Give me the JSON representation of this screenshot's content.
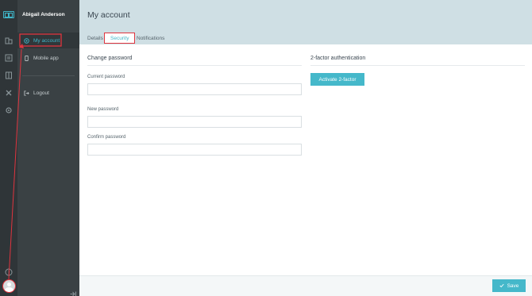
{
  "user": {
    "name": "Abigail Anderson"
  },
  "sidebar": {
    "items": [
      {
        "label": "My account",
        "icon": "gear-circle-icon"
      },
      {
        "label": "Mobile app",
        "icon": "mobile-icon"
      },
      {
        "label": "Logout",
        "icon": "logout-icon"
      }
    ]
  },
  "rail": {
    "icons": [
      "building-icon",
      "list-icon",
      "book-icon",
      "tools-icon",
      "gear-icon"
    ]
  },
  "page": {
    "title": "My account"
  },
  "tabs": [
    {
      "label": "Details"
    },
    {
      "label": "Security"
    },
    {
      "label": "Notifications"
    }
  ],
  "change_password": {
    "title": "Change password",
    "current_label": "Current password",
    "current_value": "",
    "new_label": "New password",
    "new_value": "",
    "confirm_label": "Confirm password",
    "confirm_value": ""
  },
  "two_factor": {
    "title": "2-factor authentication",
    "button_label": "Activate 2-factor"
  },
  "footer": {
    "save_label": "Save"
  },
  "colors": {
    "accent": "#3fb6c9",
    "annotation": "#e0353f",
    "sidebar_bg": "#3a4144",
    "header_bg": "#cfdfe4"
  }
}
